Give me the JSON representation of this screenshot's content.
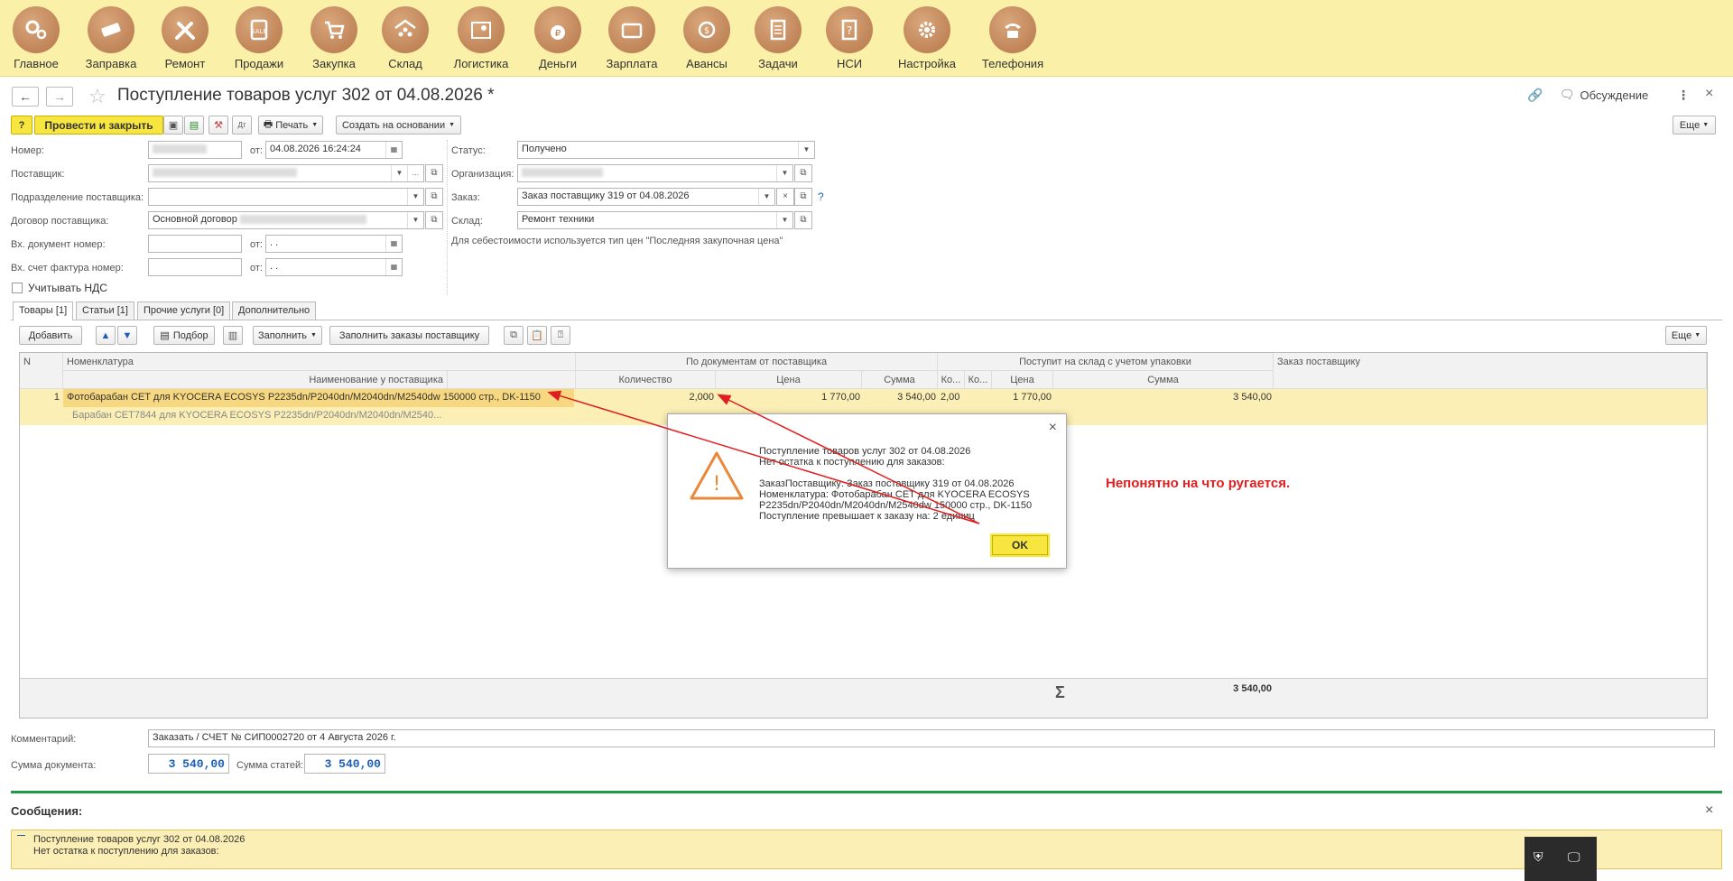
{
  "sections": [
    {
      "label": "Главное",
      "icon": "gears-icon"
    },
    {
      "label": "Заправка",
      "icon": "cartridge-icon"
    },
    {
      "label": "Ремонт",
      "icon": "tools-icon"
    },
    {
      "label": "Продажи",
      "icon": "sale-icon"
    },
    {
      "label": "Закупка",
      "icon": "cart-icon"
    },
    {
      "label": "Склад",
      "icon": "warehouse-icon"
    },
    {
      "label": "Логистика",
      "icon": "map-pin-icon"
    },
    {
      "label": "Деньги",
      "icon": "money-bag-icon"
    },
    {
      "label": "Зарплата",
      "icon": "wallet-icon"
    },
    {
      "label": "Авансы",
      "icon": "advance-icon"
    },
    {
      "label": "Задачи",
      "icon": "tasks-icon"
    },
    {
      "label": "НСИ",
      "icon": "reference-book-icon"
    },
    {
      "label": "Настройка",
      "icon": "gear-icon"
    },
    {
      "label": "Телефония",
      "icon": "phone-icon"
    }
  ],
  "header": {
    "title": "Поступление товаров услуг 302 от 04.08.2026 *",
    "discussion": "Обсуждение",
    "more_dots": "⋮",
    "close": "×"
  },
  "toolbar": {
    "help": "?",
    "post_close": "Провести и закрыть",
    "print": "Печать",
    "create_based": "Создать на основании",
    "more": "Еще"
  },
  "form": {
    "number_label": "Номер:",
    "from_label": "от:",
    "date_value": "04.08.2026 16:24:24",
    "supplier_label": "Поставщик:",
    "supplier_subdivision_label": "Подразделение поставщика:",
    "contract_label": "Договор поставщика:",
    "contract_value": "Основной договор",
    "in_doc_label": "Вх. документ номер:",
    "in_invoice_label": "Вх. счет фактура номер:",
    "empty_date": " .  .",
    "vat_label": "Учитывать НДС",
    "status_label": "Статус:",
    "status_value": "Получено",
    "org_label": "Организация:",
    "order_label": "Заказ:",
    "order_value": "Заказ поставщику 319 от 04.08.2026",
    "warehouse_label": "Склад:",
    "warehouse_value": "Ремонт техники",
    "cost_note": "Для себестоимости используется тип цен \"Последняя закупочная цена\""
  },
  "tabs": [
    "Товары [1]",
    "Статьи [1]",
    "Прочие услуги [0]",
    "Дополнительно"
  ],
  "table_toolbar": {
    "add": "Добавить",
    "pick": "Подбор",
    "fill": "Заполнить",
    "fill_orders": "Заполнить заказы поставщику",
    "more": "Еще"
  },
  "table": {
    "headers": {
      "n": "N",
      "nomenclature": "Номенклатура",
      "supplier_name": "Наименование у поставщика",
      "by_docs": "По документам от поставщика",
      "qty": "Количество",
      "price": "Цена",
      "sum": "Сумма",
      "to_warehouse": "Поступит на склад с учетом упаковки",
      "ko1": "Ко...",
      "ko2": "Ко...",
      "price2": "Цена",
      "sum2": "Сумма",
      "supplier_order": "Заказ поставщику"
    },
    "rows": [
      {
        "n": "1",
        "nomenclature": "Фотобарабан CET для KYOCERA ECOSYS P2235dn/P2040dn/M2040dn/M2540dw 150000 стр., DK-1150",
        "supplier_name": "Барабан CET7844 для KYOCERA ECOSYS P2235dn/P2040dn/M2040dn/M2540...",
        "qty": "2,000",
        "price": "1 770,00",
        "sum": "3 540,00",
        "ko": "2,00",
        "price2": "1 770,00",
        "sum2": "3 540,00"
      }
    ],
    "total_sigma": "Σ",
    "total": "3 540,00"
  },
  "dialog": {
    "line1": "Поступление товаров услуг 302 от 04.08.2026",
    "line2": "Нет остатка к поступлению для заказов:",
    "line3": "ЗаказПоставщику: Заказ поставщику 319 от 04.08.2026",
    "line4": "Номенклатура: Фотобарабан CET для KYOCERA ECOSYS",
    "line5": "P2235dn/P2040dn/M2040dn/M2540dw 150000 стр., DK-1150",
    "line6": "Поступление превышает к заказу на: 2 единиц",
    "ok": "OK",
    "close": "×"
  },
  "annotation": "Непонятно на что ругается.",
  "bottom": {
    "comment_label": "Комментарий:",
    "comment_value": "Заказать / СЧЕТ № СИП0002720 от 4 Августа 2026 г.",
    "doc_sum_label": "Сумма документа:",
    "doc_sum_value": "3 540,00",
    "items_sum_label": "Сумма статей:",
    "items_sum_value": "3 540,00"
  },
  "messages": {
    "title": "Сообщения:",
    "close": "×",
    "line1": "Поступление товаров услуг 302 от 04.08.2026",
    "line2": "Нет остатка к поступлению для заказов:"
  },
  "colors": {
    "topbar": "#fbf0a8",
    "primary_button": "#f8e640",
    "selected_row": "#fbefb6",
    "annotation": "#e02020",
    "messages_bar": "#1e9a4a"
  }
}
